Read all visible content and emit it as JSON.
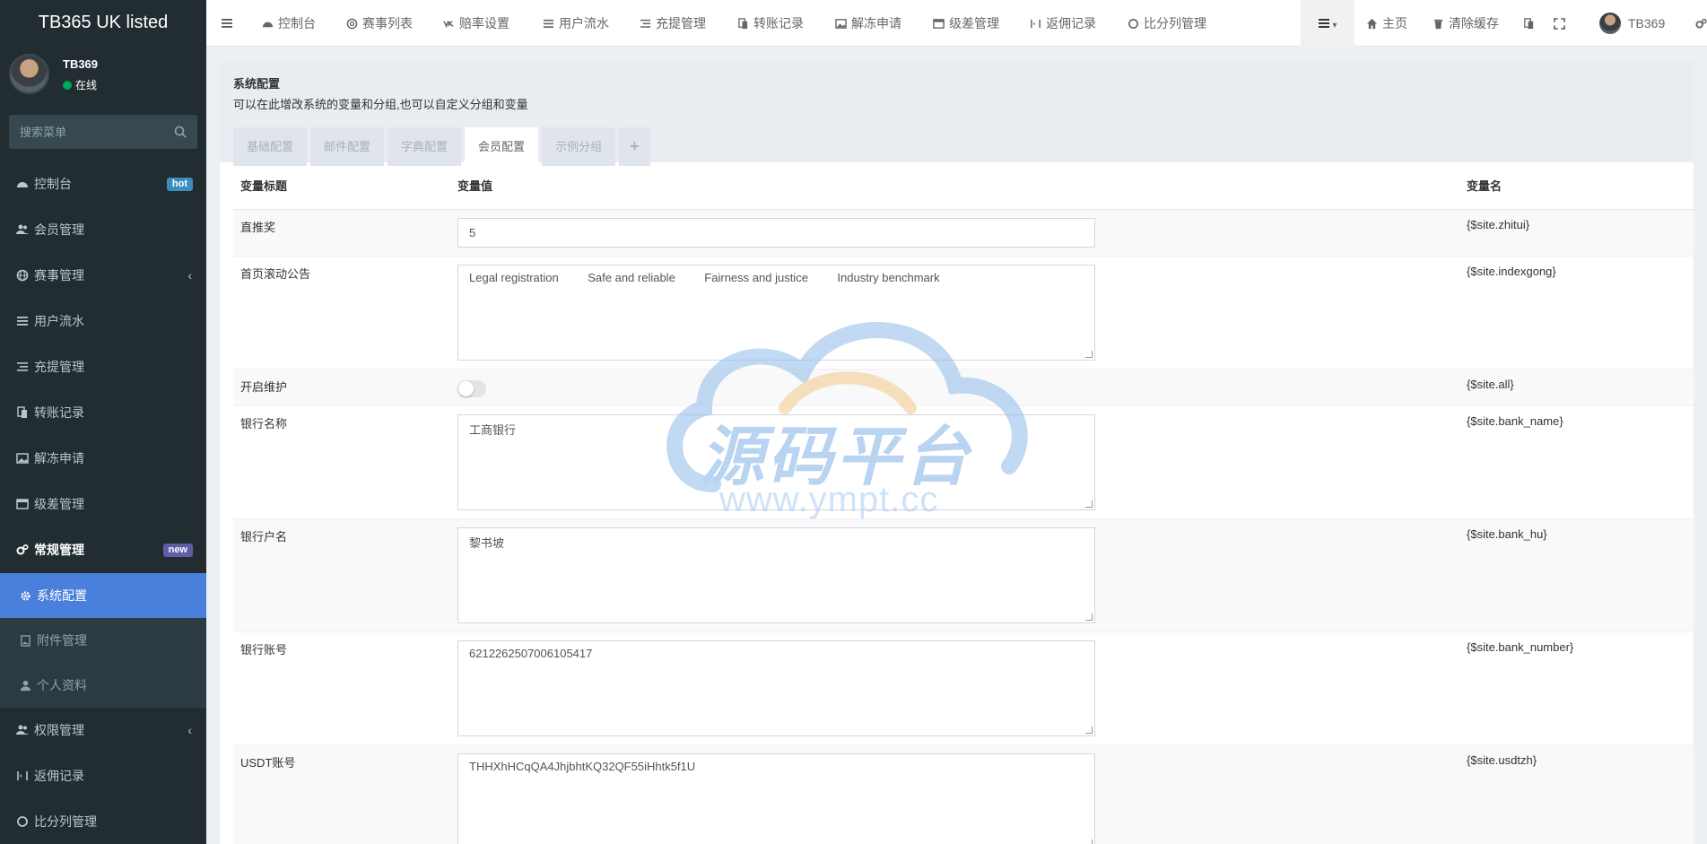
{
  "app": {
    "title": "TB365 UK listed"
  },
  "user": {
    "name": "TB369",
    "status": "在线"
  },
  "search": {
    "placeholder": "搜索菜单"
  },
  "sidebar": {
    "items": [
      {
        "label": "控制台",
        "badge": "hot",
        "badge_color": "#3c8dbc"
      },
      {
        "label": "会员管理"
      },
      {
        "label": "赛事管理",
        "chevron": "‹"
      },
      {
        "label": "用户流水"
      },
      {
        "label": "充提管理"
      },
      {
        "label": "转账记录"
      },
      {
        "label": "解冻申请"
      },
      {
        "label": "级差管理"
      },
      {
        "label": "常规管理",
        "badge": "new",
        "badge_color": "#605ca8"
      }
    ],
    "sub_items": [
      {
        "label": "系统配置"
      },
      {
        "label": "附件管理"
      },
      {
        "label": "个人资料"
      }
    ],
    "bottom_items": [
      {
        "label": "权限管理",
        "chevron": "‹"
      },
      {
        "label": "返佣记录"
      },
      {
        "label": "比分列管理"
      }
    ]
  },
  "topnav": {
    "items": [
      "控制台",
      "赛事列表",
      "赔率设置",
      "用户流水",
      "充提管理",
      "转账记录",
      "解冻申请",
      "级差管理",
      "返佣记录",
      "比分列管理"
    ],
    "right": {
      "home": "主页",
      "clear_cache": "清除缓存",
      "user": "TB369"
    }
  },
  "page": {
    "title": "系统配置",
    "description": "可以在此增改系统的变量和分组,也可以自定义分组和变量",
    "tabs": [
      "基础配置",
      "邮件配置",
      "字典配置",
      "会员配置",
      "示例分组",
      "+"
    ],
    "active_tab": "会员配置"
  },
  "table": {
    "headers": {
      "title": "变量标题",
      "value": "变量值",
      "name": "变量名"
    },
    "rows": [
      {
        "title": "直推奖",
        "value": "5",
        "name": "{$site.zhitui}",
        "type": "input"
      },
      {
        "title": "首页滚动公告",
        "value": "Legal registration         Safe and reliable         Fairness and justice         Industry benchmark",
        "name": "{$site.indexgong}",
        "type": "textarea"
      },
      {
        "title": "开启维护",
        "value": "",
        "name": "{$site.all}",
        "type": "switch"
      },
      {
        "title": "银行名称",
        "value": "工商银行",
        "name": "{$site.bank_name}",
        "type": "textarea"
      },
      {
        "title": "银行户名",
        "value": "黎书坡",
        "name": "{$site.bank_hu}",
        "type": "textarea"
      },
      {
        "title": "银行账号",
        "value": "6212262507006105417",
        "name": "{$site.bank_number}",
        "type": "textarea"
      },
      {
        "title": "USDT账号",
        "value": "THHXhHCqQA4JhjbhtKQ32QF55iHhtk5f1U",
        "name": "{$site.usdtzh}",
        "type": "textarea"
      }
    ]
  },
  "watermark": {
    "text": "源码平台",
    "url": "www.ympt.cc"
  }
}
